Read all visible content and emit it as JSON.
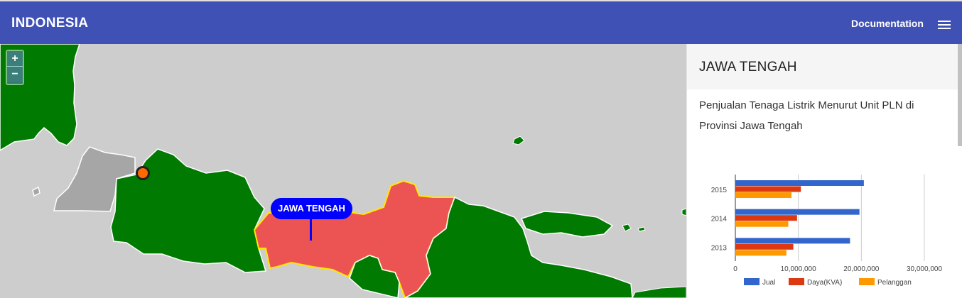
{
  "header": {
    "title": "INDONESIA",
    "doc_link": "Documentation",
    "menu_icon": "hamburger-icon"
  },
  "map": {
    "zoom_in": "+",
    "zoom_out": "−",
    "selected_label": "JAWA TENGAH",
    "colors": {
      "sea": "#cdcdcd",
      "land": "#007a00",
      "selected": "#ec5454",
      "selected_border": "#ffe800",
      "other": "#a6a6a6",
      "marker": "#ff6a00",
      "pin": "#0000ff"
    }
  },
  "panel": {
    "title": "JAWA TENGAH",
    "description": "Penjualan Tenaga Listrik Menurut Unit PLN di Provinsi Jawa Tengah"
  },
  "chart_data": {
    "type": "bar",
    "orientation": "horizontal",
    "categories": [
      "2015",
      "2014",
      "2013"
    ],
    "series": [
      {
        "name": "Jual",
        "color": "#3366cc",
        "values": [
          20400000,
          19700000,
          18200000
        ]
      },
      {
        "name": "Daya(KVA)",
        "color": "#dc3912",
        "values": [
          10400000,
          9800000,
          9200000
        ]
      },
      {
        "name": "Pelanggan",
        "color": "#ff9900",
        "values": [
          8900000,
          8400000,
          8100000
        ]
      }
    ],
    "xlim": [
      0,
      30000000
    ],
    "x_ticks": [
      "0",
      "10,000,000",
      "20,000,000",
      "30,000,000"
    ],
    "grid": true,
    "legend_position": "bottom"
  }
}
